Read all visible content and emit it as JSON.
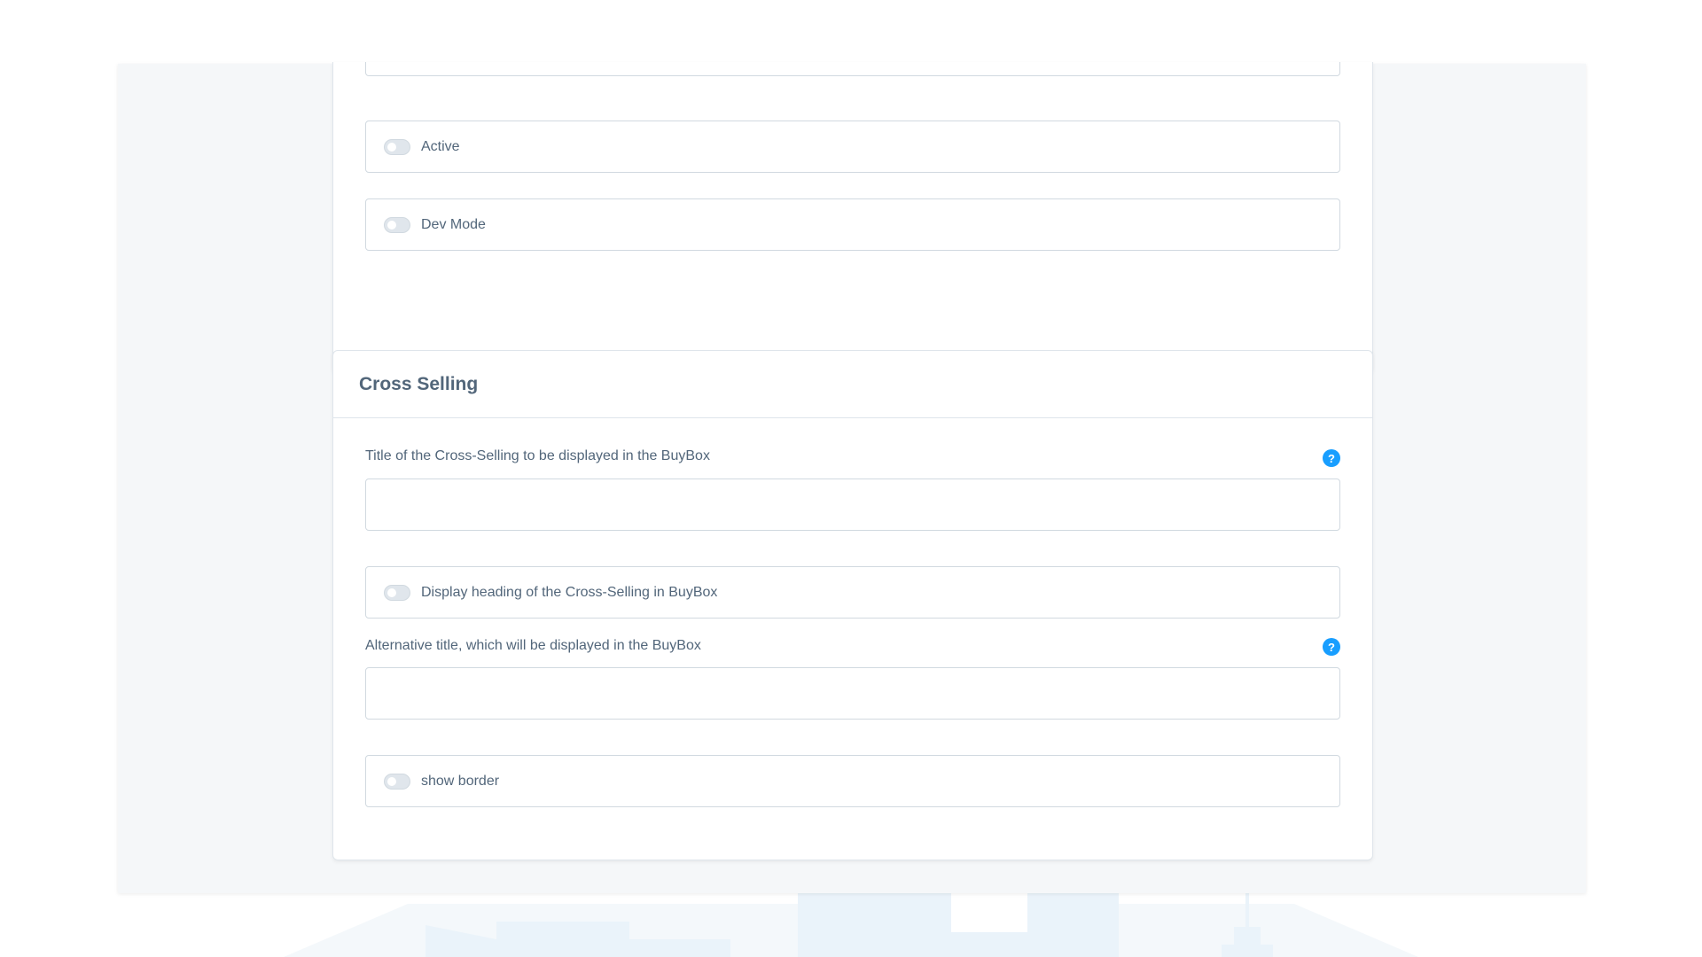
{
  "general": {
    "active_label": "Active",
    "dev_mode_label": "Dev Mode"
  },
  "cross_selling": {
    "title": "Cross Selling",
    "title_field": {
      "label": "Title of the Cross-Selling to be displayed in the BuyBox",
      "value": "",
      "help": "?"
    },
    "display_heading_label": "Display heading of the Cross-Selling in BuyBox",
    "alternative_title_field": {
      "label": "Alternative title, which will be displayed in the BuyBox",
      "value": "",
      "help": "?"
    },
    "show_border_label": "show border"
  },
  "colors": {
    "accent": "#189eff",
    "text": "#52667a",
    "border": "#d1d9e0",
    "background": "#f5f7f9"
  }
}
